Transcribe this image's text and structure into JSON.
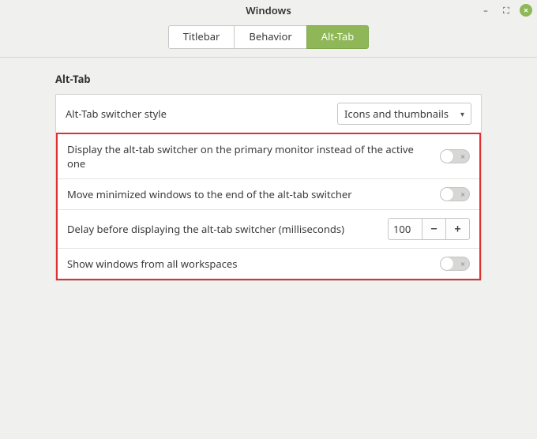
{
  "window": {
    "title": "Windows"
  },
  "tabs": {
    "titlebar": "Titlebar",
    "behavior": "Behavior",
    "alttab": "Alt-Tab"
  },
  "section": {
    "title": "Alt-Tab"
  },
  "rows": {
    "style": {
      "label": "Alt-Tab switcher style",
      "value": "Icons and thumbnails"
    },
    "primary_monitor": {
      "label": "Display the alt-tab switcher on the primary monitor instead of the active one",
      "on": false
    },
    "move_minimized": {
      "label": "Move minimized windows to the end of the alt-tab switcher",
      "on": false
    },
    "delay": {
      "label": "Delay before displaying the alt-tab switcher (milliseconds)",
      "value": "100"
    },
    "all_workspaces": {
      "label": "Show windows from all workspaces",
      "on": false
    }
  },
  "glyphs": {
    "minus": "−",
    "plus": "+",
    "x": "×",
    "caret": "▾",
    "min": "–",
    "max": "⛶"
  }
}
